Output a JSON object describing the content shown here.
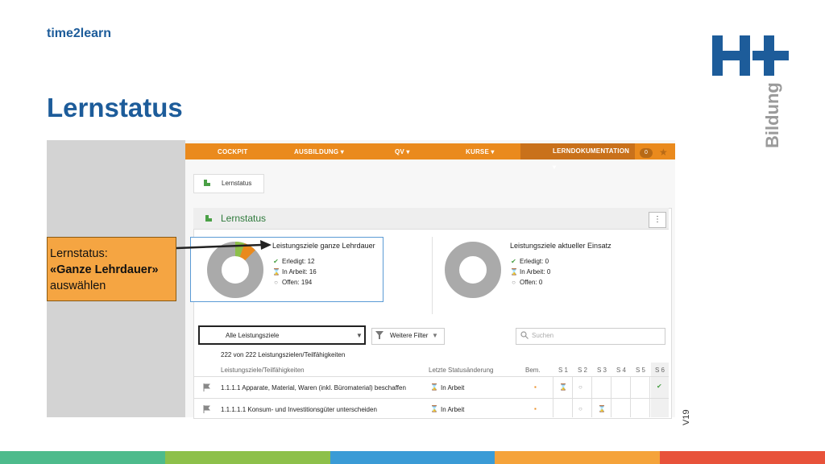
{
  "header": {
    "brand": "time2learn",
    "title": "Lernstatus",
    "logo_text": "Bildung",
    "version": "V19"
  },
  "colors": {
    "orange": "#ea8a1d",
    "blue": "#1d5c9a",
    "green": "#2f7a3c",
    "stripes": [
      "#4dbb8c",
      "#8dc04a",
      "#3a9bd6",
      "#f5a33a",
      "#e8523a"
    ]
  },
  "nav": {
    "items": [
      "COCKPIT",
      "AUSBILDUNG ▾",
      "QV ▾",
      "KURSE ▾",
      "LERNDOKUMENTATION ▾"
    ],
    "badge": "0"
  },
  "breadcrumb": {
    "label": "Lernstatus"
  },
  "panel": {
    "title": "Lernstatus",
    "menu_icon": "⋮"
  },
  "stats": [
    {
      "title": "Leistungsziele ganze Lehrdauer",
      "rows": [
        {
          "icon": "✔",
          "label": "Erledigt:",
          "value": "12"
        },
        {
          "icon": "⌛",
          "label": "In Arbeit:",
          "value": "16"
        },
        {
          "icon": "○",
          "label": "Offen:",
          "value": "194"
        }
      ],
      "fractions": {
        "erledigt": 0.054,
        "in_arbeit": 0.072,
        "offen": 0.874
      }
    },
    {
      "title": "Leistungsziele aktueller Einsatz",
      "rows": [
        {
          "icon": "✔",
          "label": "Erledigt:",
          "value": "0"
        },
        {
          "icon": "⌛",
          "label": "In Arbeit:",
          "value": "0"
        },
        {
          "icon": "○",
          "label": "Offen:",
          "value": "0"
        }
      ]
    }
  ],
  "callout": {
    "line1": "Lernstatus:",
    "line2": "«Ganze Lehrdauer»",
    "line3": "auswählen"
  },
  "filters": {
    "select_value": "Alle Leistungsziele",
    "more": "Weitere Filter",
    "search_placeholder": "Suchen"
  },
  "count_text": "222 von 222 Leistungszielen/Teilfähigkeiten",
  "table": {
    "headers": [
      "Leistungsziele/Teilfähigkeiten",
      "Letzte Statusänderung",
      "Bem.",
      "S 1",
      "S 2",
      "S 3",
      "S 4",
      "S 5",
      "S 6"
    ],
    "rows": [
      {
        "text": "1.1.1.1  Apparate, Material, Waren (inkl. Büromaterial) beschaffen",
        "status": "In Arbeit"
      },
      {
        "text": "1.1.1.1.1  Konsum- und Investitionsgüter unterscheiden",
        "status": "In Arbeit"
      }
    ]
  }
}
